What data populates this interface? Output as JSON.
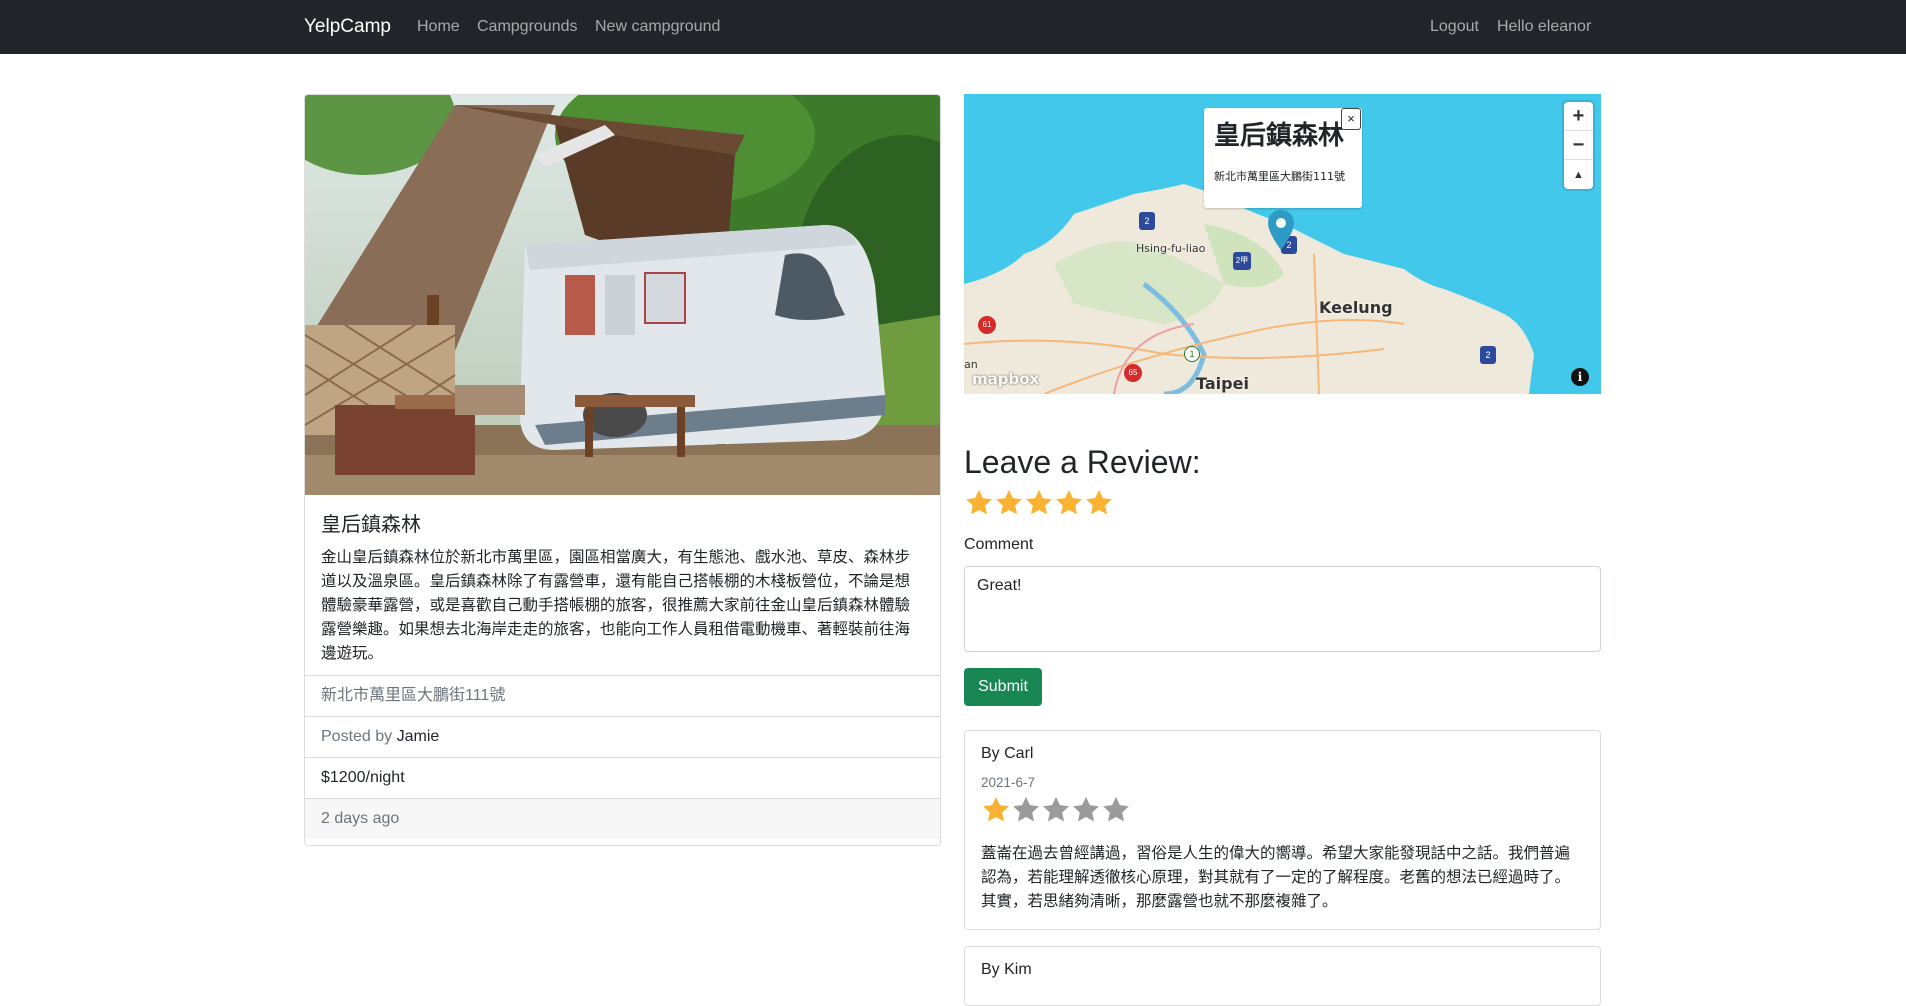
{
  "navbar": {
    "brand": "YelpCamp",
    "links": [
      "Home",
      "Campgrounds",
      "New campground"
    ],
    "logout": "Logout",
    "greeting": "Hello eleanor"
  },
  "campground": {
    "title": "皇后鎮森林",
    "description": "金山皇后鎮森林位於新北市萬里區，園區相當廣大，有生態池、戲水池、草皮、森林步道以及溫泉區。皇后鎮森林除了有露營車，還有能自己搭帳棚的木棧板營位，不論是想體驗豪華露營，或是喜歡自己動手搭帳棚的旅客，很推薦大家前往金山皇后鎮森林體驗露營樂趣。如果想去北海岸走走的旅客，也能向工作人員租借電動機車、著輕裝前往海邊遊玩。",
    "location": "新北市萬里區大鵬街111號",
    "posted_by_prefix": "Posted by",
    "author": "Jamie",
    "price": "$1200/night",
    "posted_ago": "2 days ago"
  },
  "map": {
    "popup_title": "皇后鎮森林",
    "popup_address": "新北市萬里區大鵬街111號",
    "popup_close": "×",
    "zoom_in": "+",
    "zoom_out": "−",
    "compass": "▲",
    "labels": {
      "keelung": "Keelung",
      "taipei": "Taipei",
      "hsing": "Hsing-fu-liao",
      "mapbox": "mapbox",
      "edge": "an"
    },
    "shields": [
      "2",
      "2",
      "2甲",
      "2",
      "61",
      "65",
      "1"
    ],
    "info_icon": "i"
  },
  "review_form": {
    "heading": "Leave a Review:",
    "rating": 5,
    "max_rating": 5,
    "comment_label": "Comment",
    "comment_value": "Great!",
    "submit_label": "Submit"
  },
  "reviews": [
    {
      "author": "By Carl",
      "date": "2021-6-7",
      "rating": 1,
      "body": "蓋崙在過去曾經講過，習俗是人生的偉大的嚮導。希望大家能發現話中之話。我們普遍認為，若能理解透徹核心原理，對其就有了一定的了解程度。老舊的想法已經過時了。其實，若思緒夠清晰，那麼露營也就不那麼複雜了。"
    },
    {
      "author": "By Kim"
    }
  ],
  "colors": {
    "navbar": "#212529",
    "star_filled": "#f9b233",
    "star_empty": "#9b9b9b",
    "submit": "#198754",
    "water": "#41c8ea"
  }
}
